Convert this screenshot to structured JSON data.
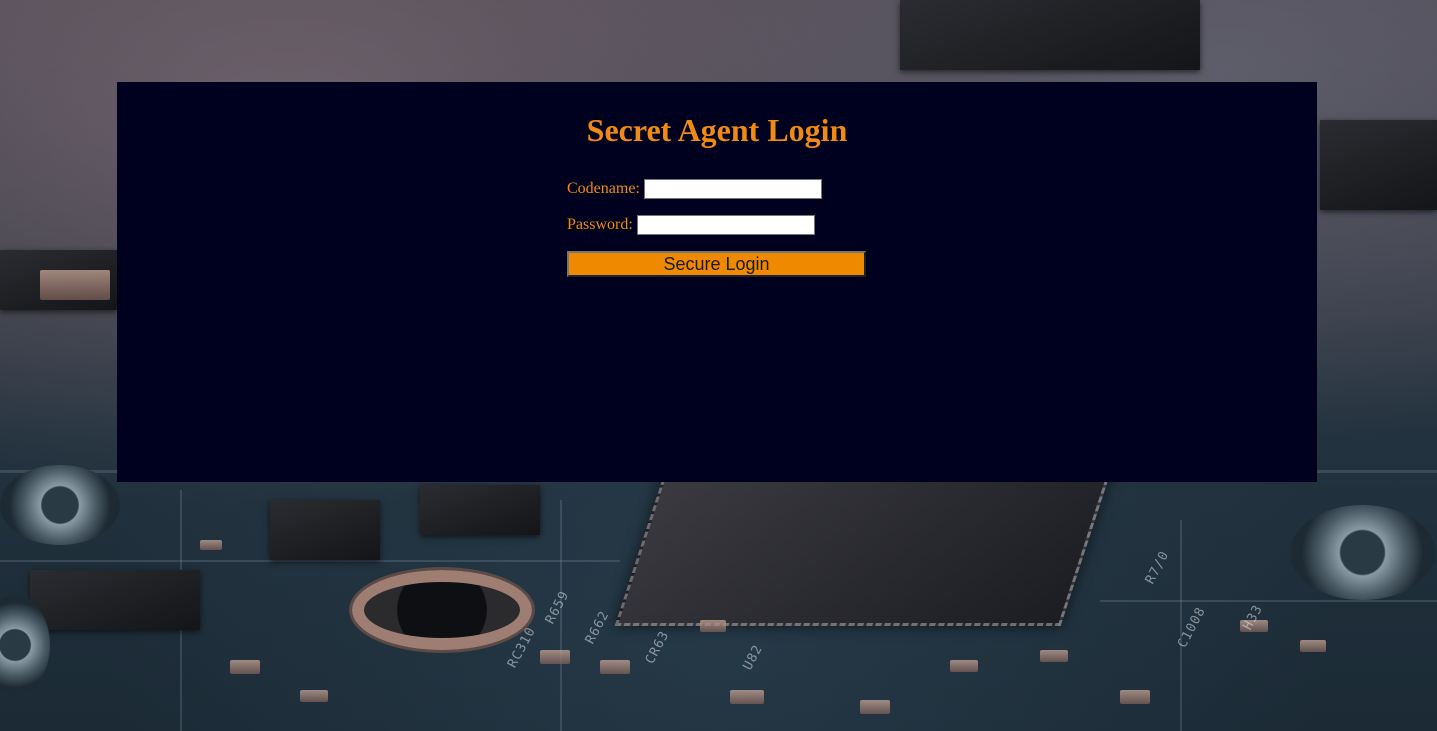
{
  "page": {
    "background": "circuit-board-photo"
  },
  "login": {
    "title": "Secret Agent Login",
    "codename_label": "Codename:",
    "codename_value": "",
    "password_label": "Password:",
    "password_value": "",
    "submit_label": "Secure Login"
  },
  "colors": {
    "panel_bg": "#00011e",
    "accent": "#ef8a14",
    "button_bg": "#ef8a00"
  }
}
